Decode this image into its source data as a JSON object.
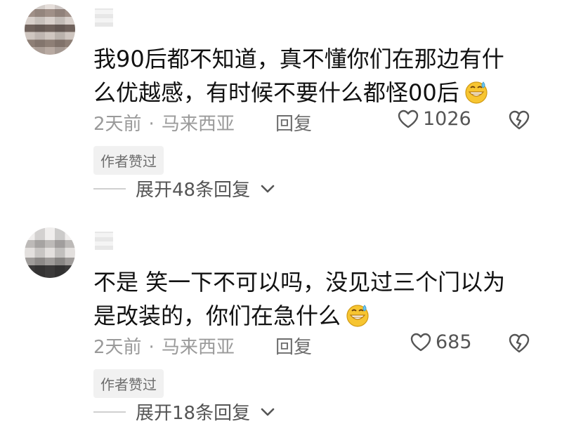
{
  "comments": [
    {
      "text_line1": "我90后都不知道，真不懂你们在那边有什",
      "text_line2": "么优越感，有时候不要什么都怪00后",
      "emoji": "sweat-grin-emoji",
      "time": "2天前",
      "location": "马来西亚",
      "reply_label": "回复",
      "likes": "1026",
      "author_badge": "作者赞过",
      "expand_label": "展开48条回复"
    },
    {
      "text_line1": "不是 笑一下不可以吗，没见过三个门以为",
      "text_line2": "是改装的，你们在急什么",
      "emoji": "sweat-grin-emoji",
      "time": "2天前",
      "location": "马来西亚",
      "reply_label": "回复",
      "likes": "685",
      "author_badge": "作者赞过",
      "expand_label": "展开18条回复"
    }
  ],
  "icons": {
    "like": "heart-outline-icon",
    "dislike": "broken-heart-icon",
    "expand": "chevron-down-icon"
  },
  "colors": {
    "text": "#111111",
    "meta": "#9a9a9a",
    "badge_bg": "#f1f1f1"
  }
}
